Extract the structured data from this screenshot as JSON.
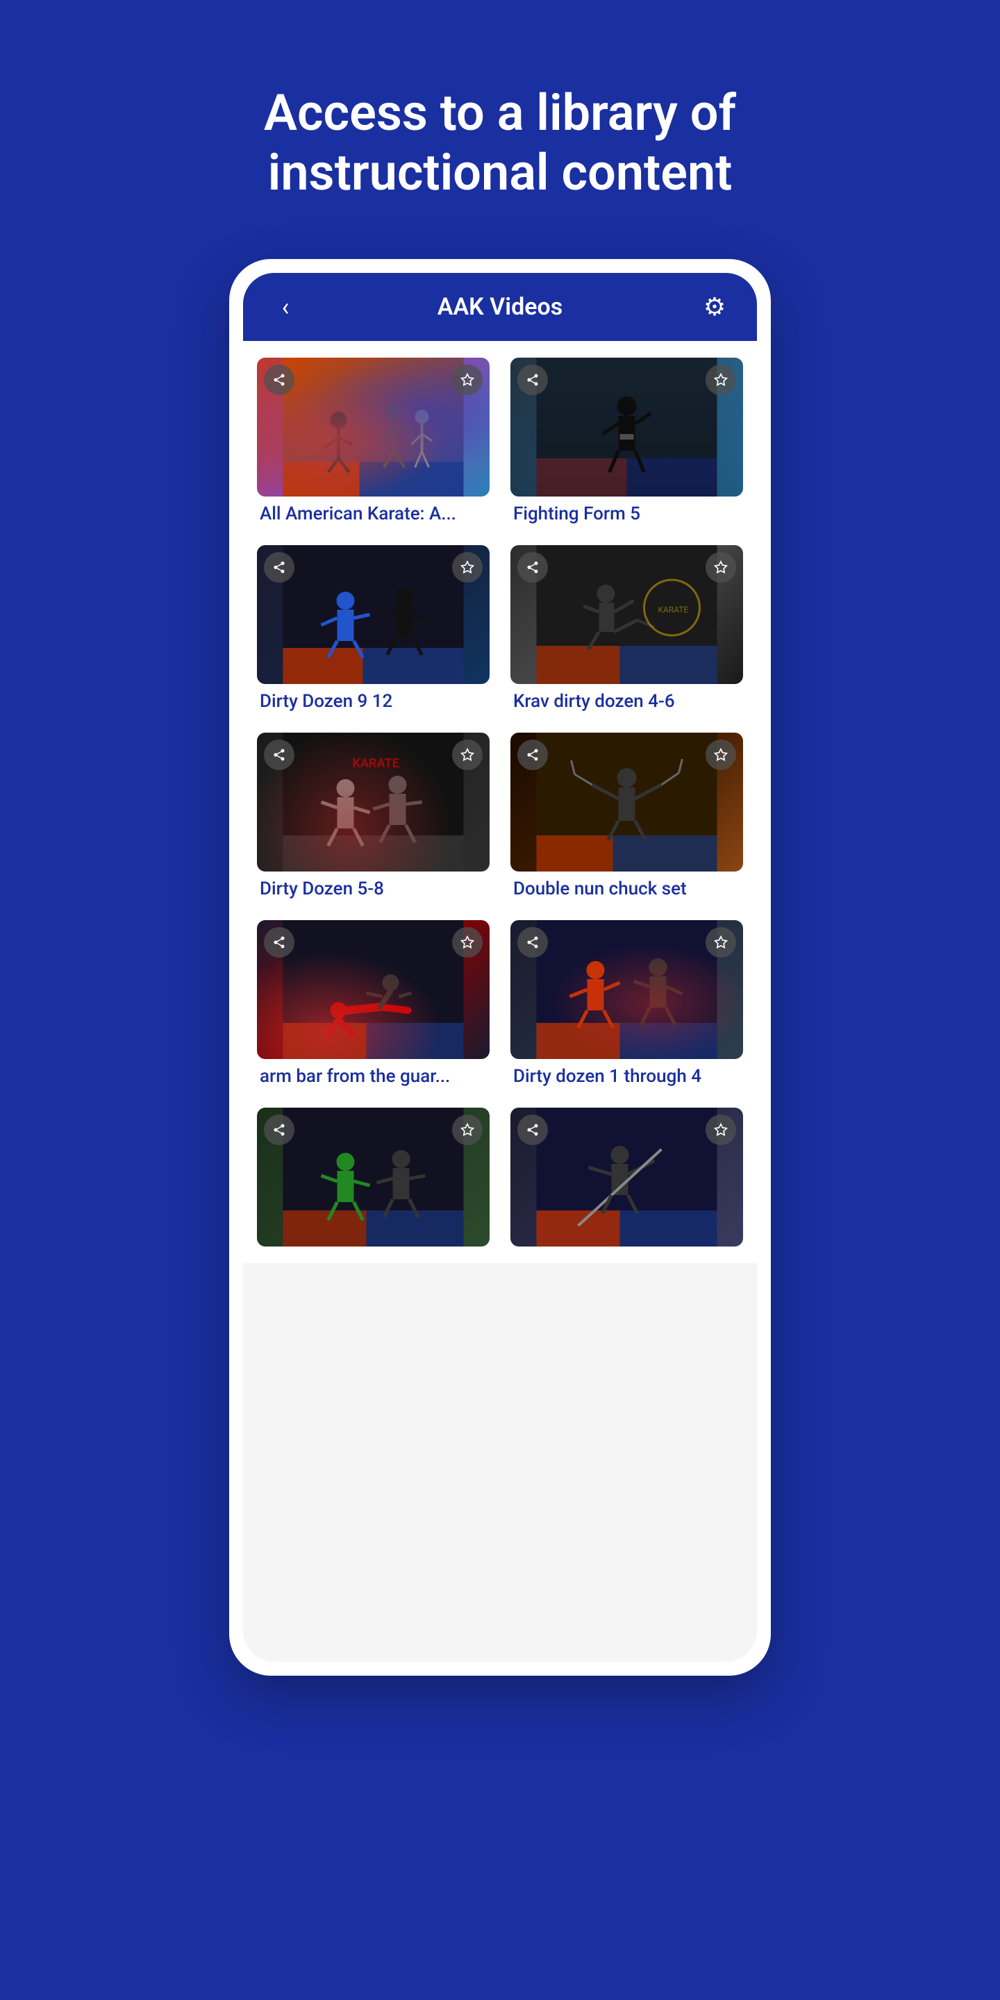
{
  "hero": {
    "title": "Access to a library of instructional content"
  },
  "header": {
    "back_label": "‹",
    "title": "AAK Videos",
    "gear_label": "⚙"
  },
  "videos": [
    {
      "id": 1,
      "title": "All American Karate: A...",
      "thumb_color_a": "#cc4400",
      "thumb_color_b": "#2244aa"
    },
    {
      "id": 2,
      "title": "Fighting Form 5",
      "thumb_color_a": "#111133",
      "thumb_color_b": "#3366cc"
    },
    {
      "id": 3,
      "title": "Dirty Dozen 9 12",
      "thumb_color_a": "#111122",
      "thumb_color_b": "#223388"
    },
    {
      "id": 4,
      "title": "Krav dirty dozen 4-6",
      "thumb_color_a": "#222222",
      "thumb_color_b": "#444444"
    },
    {
      "id": 5,
      "title": "Dirty Dozen 5-8",
      "thumb_color_a": "#111111",
      "thumb_color_b": "#333333"
    },
    {
      "id": 6,
      "title": "Double nun chuck set",
      "thumb_color_a": "#2a1500",
      "thumb_color_b": "#5a3010"
    },
    {
      "id": 7,
      "title": "arm bar from the guar...",
      "thumb_color_a": "#1a0022",
      "thumb_color_b": "#8B0000"
    },
    {
      "id": 8,
      "title": "Dirty dozen 1 through 4",
      "thumb_color_a": "#111133",
      "thumb_color_b": "#223366"
    },
    {
      "id": 9,
      "title": "",
      "thumb_color_a": "#111122",
      "thumb_color_b": "#1a3a1a"
    },
    {
      "id": 10,
      "title": "",
      "thumb_color_a": "#111133",
      "thumb_color_b": "#223366"
    }
  ],
  "icons": {
    "share": "➤",
    "star": "☆",
    "back": "‹",
    "gear": "⚙"
  }
}
